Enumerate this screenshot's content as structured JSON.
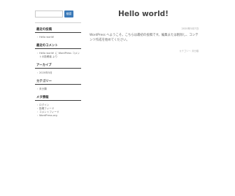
{
  "search": {
    "placeholder": "",
    "button_label": "検索"
  },
  "widgets": [
    {
      "title": "最近の投稿",
      "items": [
        "Hello world!"
      ]
    },
    {
      "title": "最近のコメント",
      "items": [
        "Hello world! に WordPress コメントの投稿者 より"
      ]
    },
    {
      "title": "アーカイブ",
      "items": [
        "2020年5月"
      ]
    },
    {
      "title": "カテゴリー",
      "items": [
        "未分類"
      ]
    },
    {
      "title": "メタ情報",
      "items": [
        "ログイン",
        "投稿フィード",
        "コメントフィード",
        "WordPress.org"
      ]
    }
  ],
  "post": {
    "title": "Hello world!",
    "date": "2020年5月7日",
    "body": "WordPress へようこそ。こちらは最初の投稿です。編集または削除し、コンテンツ作成を始めてください。",
    "meta": "カテゴリー: 未分類"
  }
}
